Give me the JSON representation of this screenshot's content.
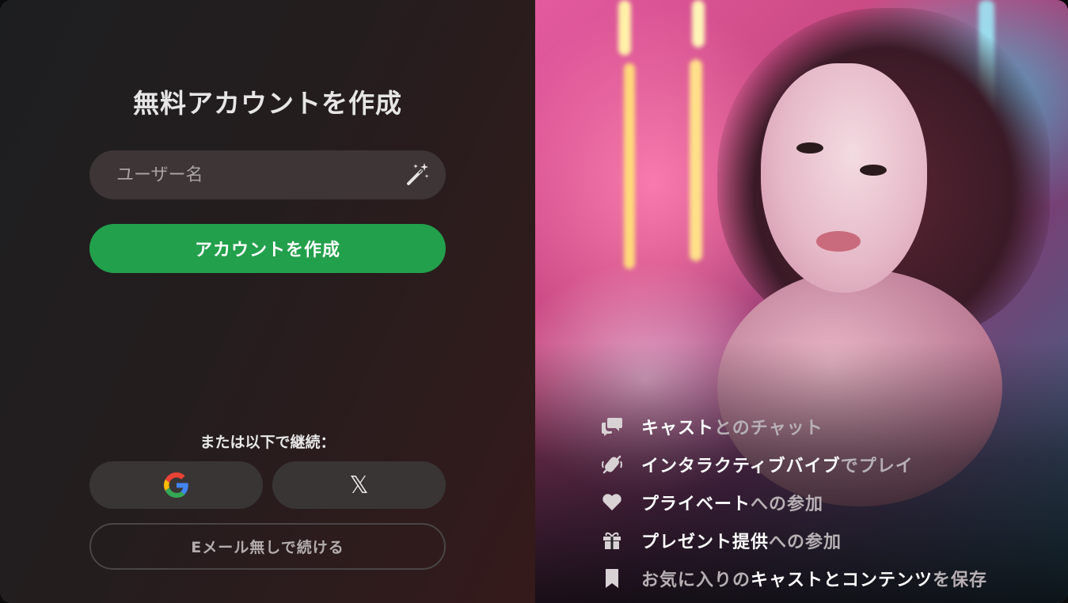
{
  "signup": {
    "title": "無料アカウントを作成",
    "username_placeholder": "ユーザー名",
    "username_value": "",
    "create_button": "アカウントを作成",
    "or_continue": "または以下で継続：",
    "x_button_glyph": "𝕏",
    "no_email_button": "Eメール無しで続ける"
  },
  "features": [
    {
      "icon": "chat-bubbles-icon",
      "parts": [
        {
          "text": "キャスト",
          "hl": true
        },
        {
          "text": "との",
          "hl": false
        },
        {
          "text": "チャット",
          "hl": false
        }
      ]
    },
    {
      "icon": "vibrate-off-icon",
      "parts": [
        {
          "text": "インタラクティブバイブ",
          "hl": true
        },
        {
          "text": "でプレイ",
          "hl": false
        }
      ]
    },
    {
      "icon": "heart-icon",
      "parts": [
        {
          "text": "プライベート",
          "hl": true
        },
        {
          "text": "への参加",
          "hl": false
        }
      ]
    },
    {
      "icon": "gift-icon",
      "parts": [
        {
          "text": "プレゼント提供",
          "hl": true
        },
        {
          "text": "への参加",
          "hl": false
        }
      ]
    },
    {
      "icon": "bookmark-icon",
      "parts": [
        {
          "text": "お気に入りの",
          "hl": false
        },
        {
          "text": "キャストとコンテンツ",
          "hl": true
        },
        {
          "text": "を保存",
          "hl": false
        }
      ]
    }
  ],
  "colors": {
    "primary_button": "#22a04b",
    "left_panel_start": "#1d1e20",
    "left_panel_end": "#351a1b",
    "field_bg": "#3d3536",
    "social_bg": "#3a3535"
  }
}
